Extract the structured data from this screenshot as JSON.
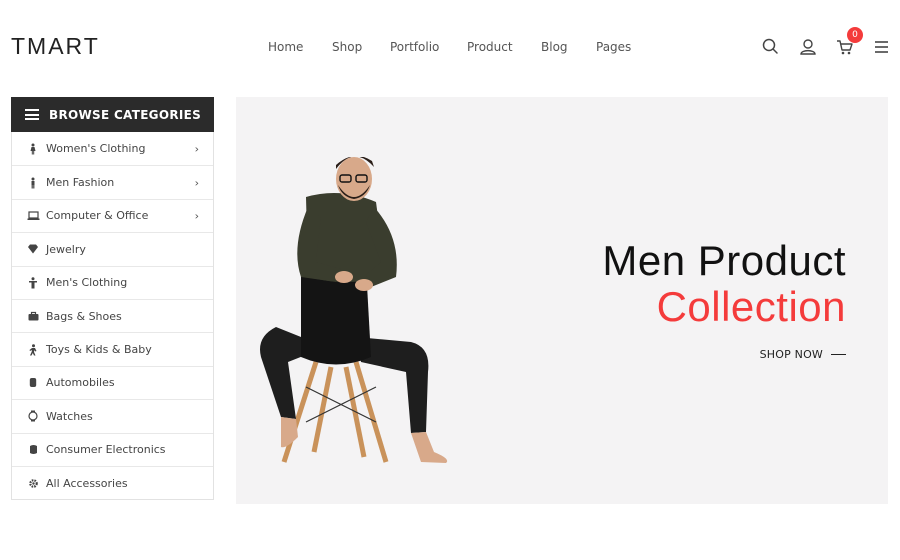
{
  "header": {
    "logo": "TMART",
    "nav": [
      "Home",
      "Shop",
      "Portfolio",
      "Product",
      "Blog",
      "Pages"
    ],
    "cart_count": "0",
    "icons": [
      "search-icon",
      "user-icon",
      "cart-icon",
      "menu-icon"
    ]
  },
  "sidebar": {
    "title": "BROWSE CATEGORIES",
    "items": [
      {
        "label": "Women's Clothing",
        "icon": "woman-icon",
        "has_submenu": true
      },
      {
        "label": "Men Fashion",
        "icon": "man-icon",
        "has_submenu": true
      },
      {
        "label": "Computer & Office",
        "icon": "laptop-icon",
        "has_submenu": true
      },
      {
        "label": "Jewelry",
        "icon": "diamond-icon",
        "has_submenu": false
      },
      {
        "label": "Men's Clothing",
        "icon": "shirt-icon",
        "has_submenu": false
      },
      {
        "label": "Bags & Shoes",
        "icon": "bag-icon",
        "has_submenu": false
      },
      {
        "label": "Toys & Kids & Baby",
        "icon": "child-icon",
        "has_submenu": false
      },
      {
        "label": "Automobiles",
        "icon": "car-icon",
        "has_submenu": false
      },
      {
        "label": "Watches",
        "icon": "watch-icon",
        "has_submenu": false
      },
      {
        "label": "Consumer Electronics",
        "icon": "electronics-icon",
        "has_submenu": false
      },
      {
        "label": "All Accessories",
        "icon": "gear-icon",
        "has_submenu": false
      }
    ]
  },
  "hero": {
    "title_line1": "Men Product",
    "title_line2": "Collection",
    "cta": "SHOP NOW"
  },
  "colors": {
    "accent": "#f43b3b",
    "sidebar_header_bg": "#2b2b2b",
    "hero_bg": "#f4f3f4"
  }
}
